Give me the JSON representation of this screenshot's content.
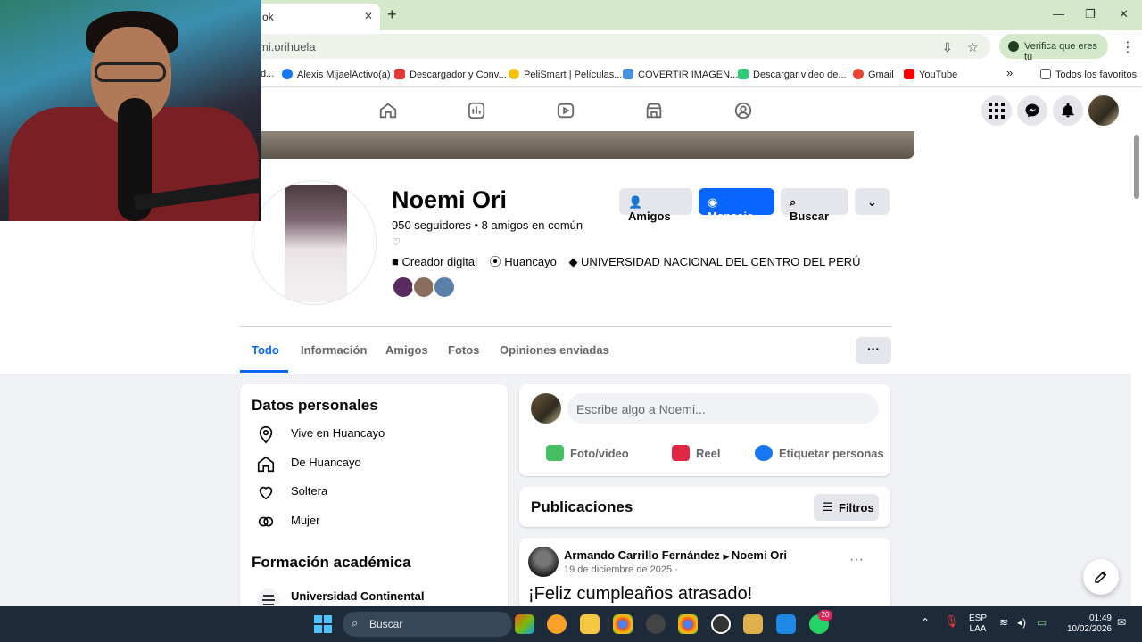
{
  "browser": {
    "tab_title": "ok",
    "url": "mi.orihuela",
    "verify_label": "Verifica que eres tú",
    "bookmarks": [
      {
        "label": "d...",
        "color": "#555555"
      },
      {
        "label": "Alexis MijaelActivo(a)",
        "color": "#1877f2"
      },
      {
        "label": "Descargador y Conv...",
        "color": "#e53935"
      },
      {
        "label": "PeliSmart | Películas...",
        "color": "#f4c20d"
      },
      {
        "label": "COVERTIR IMAGEN...",
        "color": "#4a90e2"
      },
      {
        "label": "Descargar video de...",
        "color": "#2ecc71"
      },
      {
        "label": "Gmail",
        "color": "#ea4335"
      },
      {
        "label": "YouTube",
        "color": "#ff0000"
      }
    ],
    "bookmarks_more": "»",
    "all_bookmarks": "Todos los favoritos"
  },
  "profile": {
    "name": "Noemi Ori",
    "meta": "950 seguidores • 8 amigos en común",
    "heart": "♡",
    "info": [
      {
        "icon": "briefcase-icon",
        "text": "Creador digital"
      },
      {
        "icon": "location-icon",
        "text": "Huancayo"
      },
      {
        "icon": "graduation-icon",
        "text": "UNIVERSIDAD NACIONAL DEL CENTRO DEL PERÚ"
      }
    ],
    "friend_avatar_colors": [
      "#5b2a5e",
      "#8a6d5a",
      "#5a7fa8"
    ],
    "buttons": {
      "friends": "Amigos",
      "message": "Mensaje",
      "search": "Buscar"
    },
    "tabs": [
      "Todo",
      "Información",
      "Amigos",
      "Fotos",
      "Opiniones enviadas"
    ],
    "more_tabs": "···"
  },
  "personal": {
    "title": "Datos personales",
    "items": [
      {
        "icon": "location-icon",
        "text": "Vive en Huancayo"
      },
      {
        "icon": "home-icon",
        "text": "De Huancayo"
      },
      {
        "icon": "heart-icon",
        "text": "Soltera"
      },
      {
        "icon": "gender-icon",
        "text": "Mujer"
      }
    ],
    "education_title": "Formación académica",
    "education_item": "Universidad Continental"
  },
  "composer": {
    "placeholder": "Escribe algo a Noemi...",
    "actions": [
      {
        "label": "Foto/video",
        "color": "#45bd62"
      },
      {
        "label": "Reel",
        "color": "#e42645"
      },
      {
        "label": "Etiquetar personas",
        "color": "#1877f2"
      }
    ]
  },
  "posts": {
    "title": "Publicaciones",
    "filters": "Filtros",
    "item": {
      "author": "Armando Carrillo Fernández",
      "target": "Noemi Ori",
      "date": "19 de diciembre de 2025 ·",
      "text": "¡Feliz cumpleaños atrasado!"
    }
  },
  "taskbar": {
    "search": "Buscar",
    "lang_top": "ESP",
    "lang_bottom": "LAA",
    "time": "01:49",
    "date": "10/02/2026",
    "whatsapp_badge": "20"
  }
}
